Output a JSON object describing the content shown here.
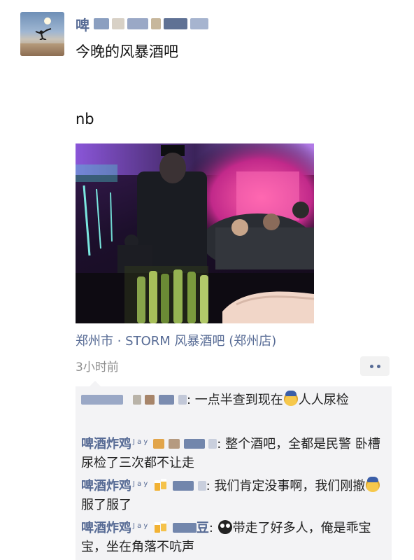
{
  "post": {
    "username_visible": "啤",
    "text": "今晚的风暴酒吧",
    "text2": "nb",
    "location": "郑州市 · STORM 风暴酒吧 (郑州店)",
    "time": "3小时前"
  },
  "icons": {
    "more": "more-dots-icon",
    "officer_emoji": "police-officer-emoji",
    "beer_emoji": "beer-mugs-emoji",
    "ghost_emoji": "black-ghost-emoji"
  },
  "comments": [
    {
      "name": "",
      "sep": ":",
      "text_a": "一点半查到现在",
      "text_b": "人人尿检"
    },
    {
      "name": "啤酒炸鸡",
      "sup": "J a y",
      "sep": ":",
      "text_a": "整个酒吧，全都是民警 卧槽 尿检了三次都不让走"
    },
    {
      "name": "啤酒炸鸡",
      "sup": "J a y",
      "sep": ":",
      "text_a": "我们肯定没事啊，我们刚撤",
      "text_b": "服了服了"
    },
    {
      "name": "啤酒炸鸡",
      "sup": "J a y",
      "reply_suffix": "豆",
      "sep": ":",
      "text_a": "带走了好多人，俺是乖宝宝，坐在角落不吭声"
    }
  ],
  "colors": {
    "link": "#576b95",
    "comment_bg": "#f3f3f5",
    "time": "#8f8f8f"
  }
}
